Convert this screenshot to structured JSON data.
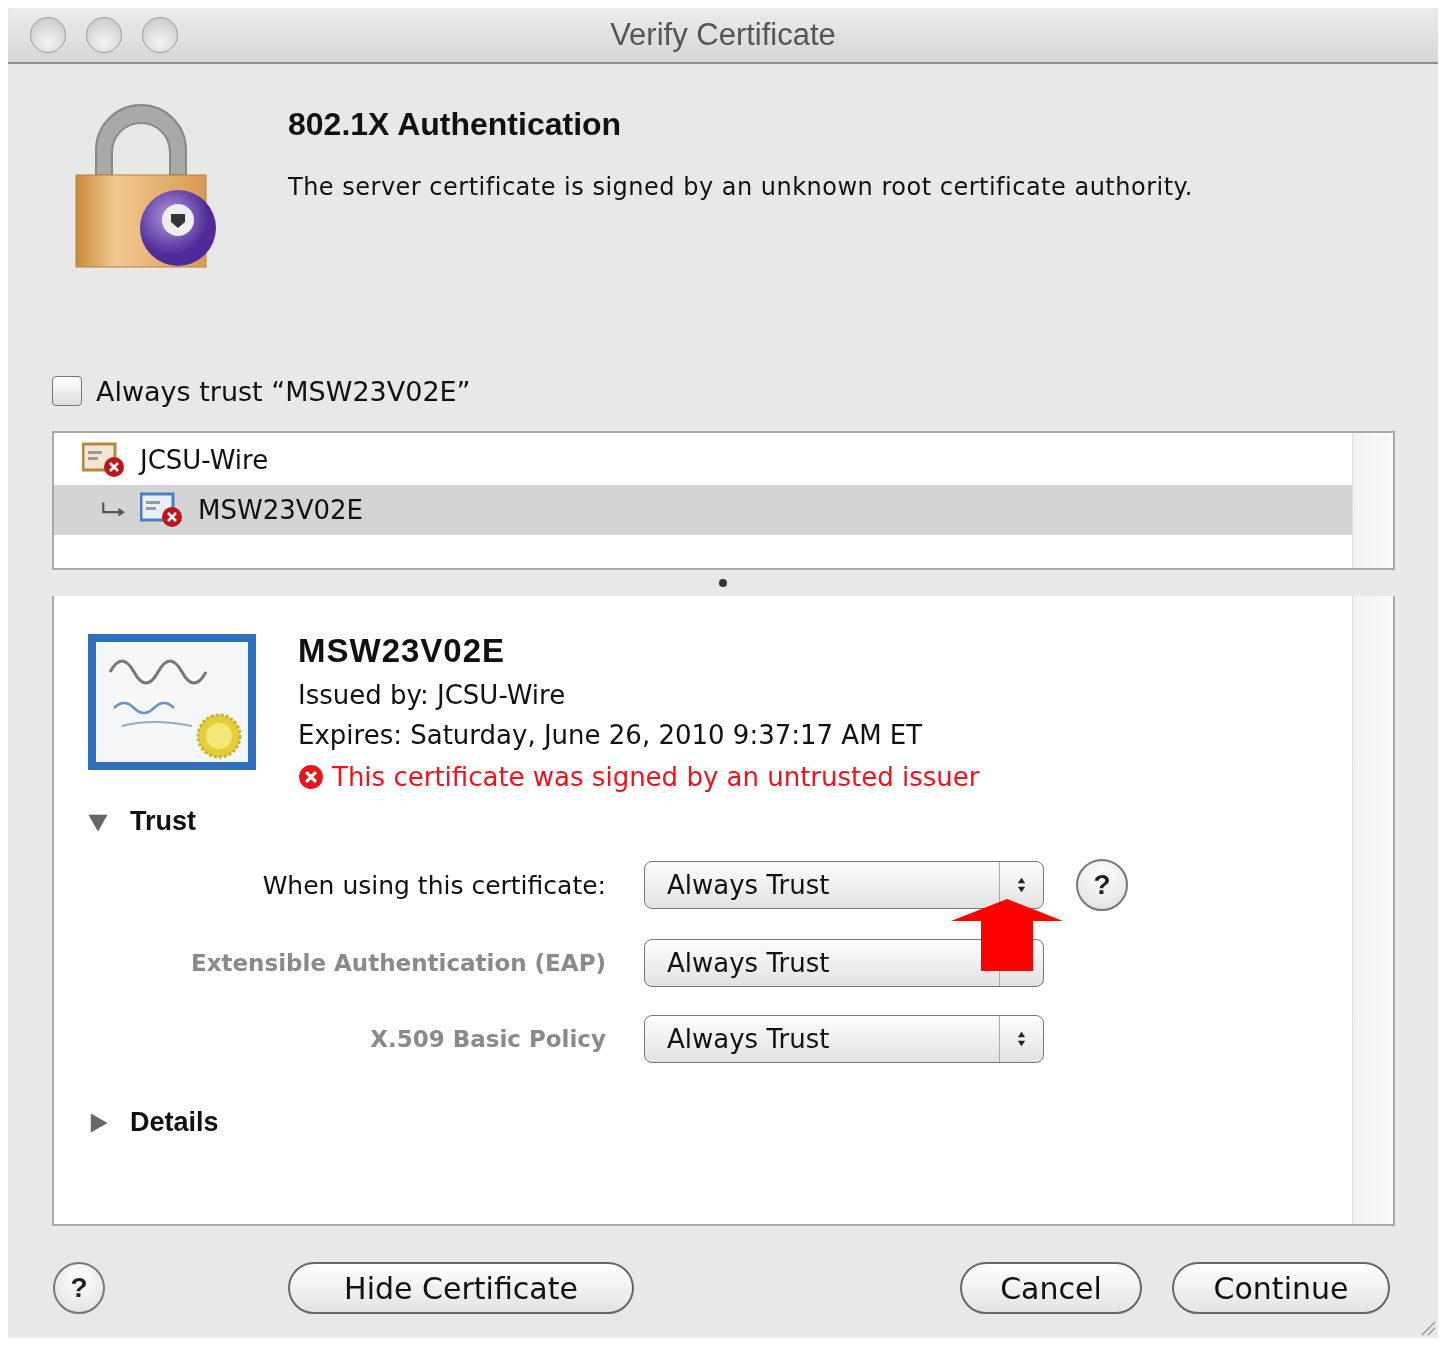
{
  "window": {
    "title": "Verify Certificate"
  },
  "header": {
    "title": "802.1X Authentication",
    "message": "The server certificate is signed by an unknown root certificate authority."
  },
  "always_trust": {
    "label": "Always trust “MSW23V02E”",
    "checked": false
  },
  "chain": [
    {
      "name": "JCSU-Wire",
      "selected": false,
      "children": [
        {
          "name": "MSW23V02E",
          "selected": true
        }
      ]
    }
  ],
  "certificate": {
    "name": "MSW23V02E",
    "issued_by": "Issued by: JCSU-Wire",
    "expires": "Expires: Saturday, June 26, 2010 9:37:17 AM ET",
    "status": "This certificate was signed by an untrusted issuer"
  },
  "trust": {
    "label": "Trust",
    "expanded": true,
    "help": "?",
    "rows": [
      {
        "label": "When using this certificate:",
        "value": "Always Trust",
        "disabled": false
      },
      {
        "label": "Extensible Authentication (EAP)",
        "value": "Always Trust",
        "disabled": true
      },
      {
        "label": "X.509 Basic Policy",
        "value": "Always Trust",
        "disabled": true
      }
    ]
  },
  "details": {
    "label": "Details",
    "expanded": false
  },
  "buttons": {
    "help": "?",
    "hide": "Hide Certificate",
    "cancel": "Cancel",
    "continue": "Continue"
  }
}
